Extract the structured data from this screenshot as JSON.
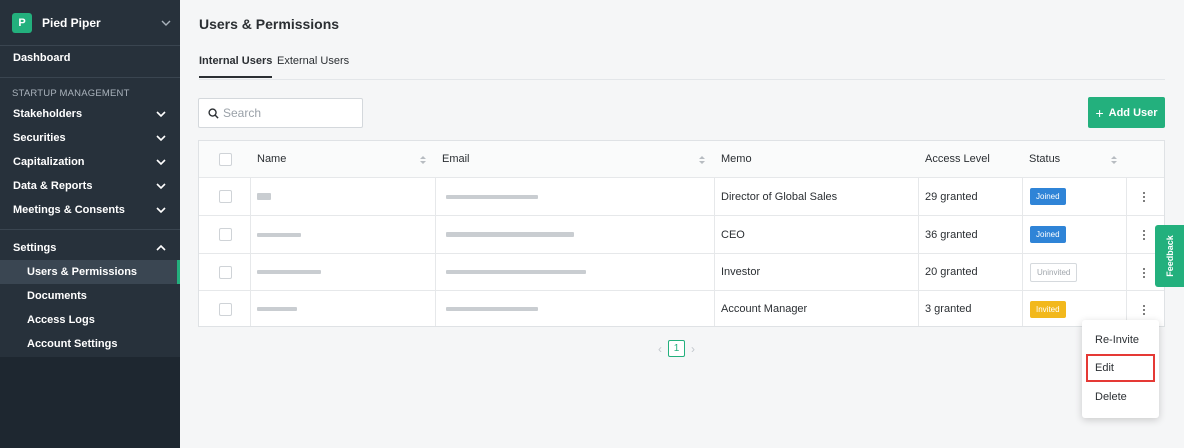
{
  "org": {
    "initial": "P",
    "name": "Pied Piper"
  },
  "sidebar": {
    "dashboard": "Dashboard",
    "section_label": "STARTUP MANAGEMENT",
    "items": [
      {
        "label": "Stakeholders"
      },
      {
        "label": "Securities"
      },
      {
        "label": "Capitalization"
      },
      {
        "label": "Data & Reports"
      },
      {
        "label": "Meetings & Consents"
      }
    ],
    "settings": "Settings",
    "settings_sub": [
      {
        "label": "Users & Permissions",
        "active": true
      },
      {
        "label": "Documents"
      },
      {
        "label": "Access Logs"
      },
      {
        "label": "Account Settings"
      }
    ]
  },
  "page": {
    "title": "Users & Permissions",
    "tabs": [
      {
        "label": "Internal Users",
        "active": true
      },
      {
        "label": "External Users"
      }
    ],
    "search_placeholder": "Search",
    "add_user_label": "Add User"
  },
  "table": {
    "columns": [
      "Name",
      "Email",
      "Memo",
      "Access Level",
      "Status"
    ],
    "rows": [
      {
        "memo": "Director of Global Sales",
        "access": "29 granted",
        "status": "Joined"
      },
      {
        "memo": "CEO",
        "access": "36 granted",
        "status": "Joined"
      },
      {
        "memo": "Investor",
        "access": "20 granted",
        "status": "Uninvited"
      },
      {
        "memo": "Account Manager",
        "access": "3 granted",
        "status": "Invited"
      }
    ]
  },
  "pagination": {
    "current": "1"
  },
  "menu": {
    "items": [
      "Re-Invite",
      "Edit",
      "Delete"
    ]
  },
  "feedback": "Feedback",
  "colors": {
    "brand": "#23b07d",
    "sidebar": "#27313b",
    "joined": "#2f84d7",
    "invited": "#f2b81c",
    "highlight": "#e53935"
  }
}
